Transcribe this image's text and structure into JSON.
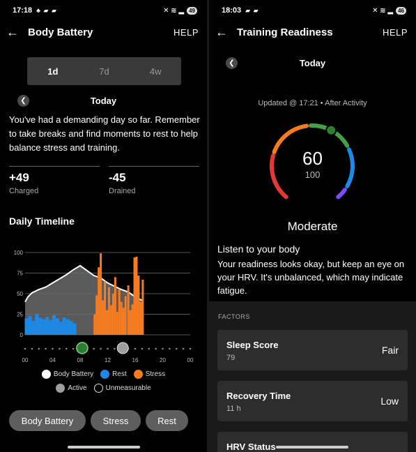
{
  "left": {
    "status": {
      "time": "17:18",
      "icons_left": "♣ ▰ ▰",
      "icons_right": "✕ ≋ ▂",
      "battery": "49"
    },
    "appbar": {
      "title": "Body Battery",
      "help": "HELP"
    },
    "range_tabs": [
      {
        "label": "1d",
        "active": true
      },
      {
        "label": "7d",
        "active": false
      },
      {
        "label": "4w",
        "active": false
      }
    ],
    "day_label": "Today",
    "description": "You've had a demanding day so far. Remember to take breaks and find moments to rest to help balance stress and training.",
    "charged": {
      "value": "+49",
      "label": "Charged"
    },
    "drained": {
      "value": "-45",
      "label": "Drained"
    },
    "timeline_title": "Daily Timeline",
    "legend": [
      {
        "label": "Body Battery",
        "color": "#ffffff"
      },
      {
        "label": "Rest",
        "color": "#1e88e5"
      },
      {
        "label": "Stress",
        "color": "#f57c20"
      },
      {
        "label": "Active",
        "color": "#9e9e9e"
      },
      {
        "label": "Unmeasurable",
        "color": "#000000"
      }
    ],
    "pills": [
      "Body Battery",
      "Stress",
      "Rest"
    ]
  },
  "right": {
    "status": {
      "time": "18:03",
      "icons_left": "▰ ▰",
      "icons_right": "✕ ≋ ▂",
      "battery": "46"
    },
    "appbar": {
      "title": "Training Readiness",
      "help": "HELP"
    },
    "day_label": "Today",
    "updated": "Updated @ 17:21 • After Activity",
    "score": "60",
    "max": "100",
    "status_label": "Moderate",
    "heading": "Listen to your body",
    "text": "Your readiness looks okay, but keep an eye on your HRV. It's unbalanced, which may indicate fatigue.",
    "factors_title": "FACTORS",
    "factors": [
      {
        "title": "Sleep Score",
        "sub": "79",
        "value": "Fair"
      },
      {
        "title": "Recovery Time",
        "sub": "11 h",
        "value": "Low"
      },
      {
        "title": "HRV Status",
        "sub": "",
        "value": ""
      }
    ],
    "gauge_colors": [
      "#e53935",
      "#f57c20",
      "#43a047",
      "#1e88e5",
      "#7c4dff"
    ]
  },
  "chart_data": {
    "type": "area",
    "title": "Daily Timeline",
    "x_ticks": [
      "00",
      "04",
      "08",
      "12",
      "16",
      "20",
      "00"
    ],
    "y_ticks": [
      "0",
      "25",
      "50",
      "75",
      "100"
    ],
    "ylim": [
      0,
      100
    ],
    "xlim": [
      0,
      24
    ],
    "body_battery": {
      "x": [
        0,
        0.4,
        1,
        2,
        3,
        4,
        5,
        6,
        7,
        8,
        9,
        10,
        11,
        12,
        13,
        14,
        15,
        16,
        17.2
      ],
      "y": [
        40,
        46,
        51,
        55,
        58,
        63,
        68,
        73,
        79,
        84,
        78,
        72,
        69,
        63,
        59,
        55,
        52,
        46,
        41
      ]
    },
    "rest": {
      "x": [
        0.2,
        0.7,
        1.2,
        1.7,
        2.2,
        2.7,
        3.2,
        3.7,
        4.2,
        4.7,
        5.2,
        5.7,
        6.2,
        6.7,
        7.2
      ],
      "y": [
        20,
        23,
        17,
        25,
        21,
        19,
        22,
        18,
        24,
        20,
        16,
        21,
        19,
        17,
        14
      ]
    },
    "stress": {
      "x": [
        10.1,
        10.4,
        10.7,
        11.0,
        11.3,
        11.6,
        11.9,
        12.2,
        12.5,
        12.8,
        13.1,
        13.4,
        13.7,
        14.0,
        14.3,
        14.6,
        15.0,
        15.3,
        15.6,
        15.9,
        16.2,
        16.5,
        16.8,
        17.1
      ],
      "y": [
        25,
        48,
        82,
        99,
        42,
        65,
        30,
        58,
        36,
        50,
        70,
        28,
        55,
        40,
        33,
        47,
        60,
        30,
        37,
        94,
        95,
        72,
        40,
        67
      ]
    }
  }
}
